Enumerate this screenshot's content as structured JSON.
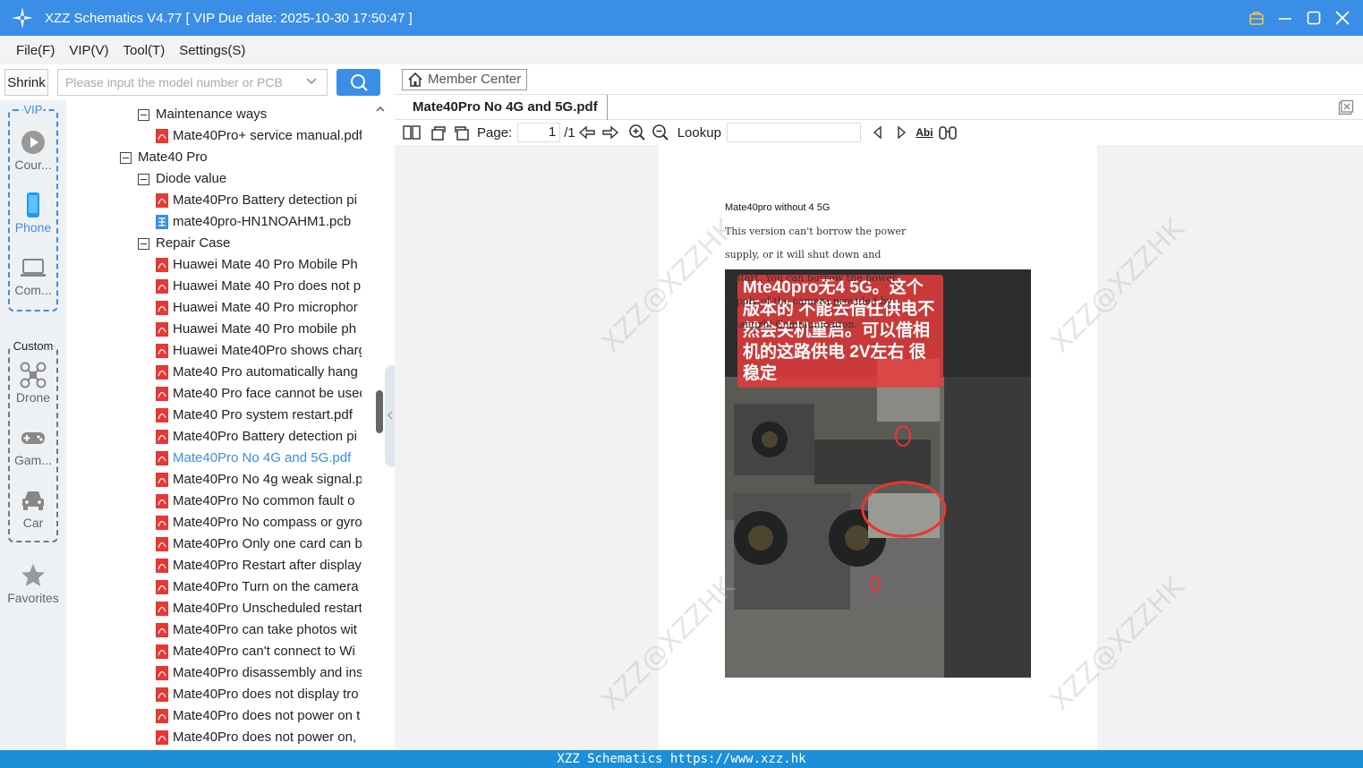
{
  "titlebar": {
    "title": "XZZ Schematics V4.77 [ VIP Due date: 2025-10-30 17:50:47 ]"
  },
  "menu": {
    "items": [
      "File(F)",
      "VIP(V)",
      "Tool(T)",
      "Settings(S)"
    ]
  },
  "search": {
    "shrink_label": "Shrink",
    "placeholder": "Please input the model number or PCB"
  },
  "categories": {
    "vip_label": "VIP",
    "custom_label": "Custom",
    "items": [
      "Cour...",
      "Phone",
      "Com...",
      "Drone",
      "Gam...",
      "Car",
      "Favorites"
    ]
  },
  "tree": {
    "nodes": [
      {
        "text": "Maintenance ways",
        "kind": "folder"
      },
      {
        "text": "Mate40Pro+ service manual.pdf",
        "kind": "pdf"
      },
      {
        "text": "Mate40 Pro",
        "kind": "folder"
      },
      {
        "text": "Diode value",
        "kind": "folder"
      },
      {
        "text": "Mate40Pro Battery detection pi",
        "kind": "pdf"
      },
      {
        "text": "mate40pro-HN1NOAHM1.pcb",
        "kind": "pcb"
      },
      {
        "text": "Repair Case",
        "kind": "folder"
      },
      {
        "text": "Huawei Mate 40 Pro Mobile Ph",
        "kind": "pdf"
      },
      {
        "text": "Huawei Mate 40 Pro does not p",
        "kind": "pdf"
      },
      {
        "text": "Huawei Mate 40 Pro microphor",
        "kind": "pdf"
      },
      {
        "text": "Huawei Mate 40 Pro mobile ph",
        "kind": "pdf"
      },
      {
        "text": "Huawei Mate40Pro shows charg",
        "kind": "pdf"
      },
      {
        "text": "Mate40 Pro automatically hang",
        "kind": "pdf"
      },
      {
        "text": "Mate40 Pro face cannot be used",
        "kind": "pdf"
      },
      {
        "text": "Mate40 Pro system restart.pdf",
        "kind": "pdf"
      },
      {
        "text": "Mate40Pro Battery detection pi",
        "kind": "pdf"
      },
      {
        "text": "Mate40Pro No 4G and 5G.pdf",
        "kind": "pdf"
      },
      {
        "text": "Mate40Pro No 4g weak signal.p",
        "kind": "pdf"
      },
      {
        "text": "Mate40Pro No common fault o",
        "kind": "pdf"
      },
      {
        "text": "Mate40Pro No compass or gyro",
        "kind": "pdf"
      },
      {
        "text": "Mate40Pro Only one card can b",
        "kind": "pdf"
      },
      {
        "text": "Mate40Pro Restart after display",
        "kind": "pdf"
      },
      {
        "text": "Mate40Pro Turn on the camera",
        "kind": "pdf"
      },
      {
        "text": "Mate40Pro Unscheduled restart",
        "kind": "pdf"
      },
      {
        "text": "Mate40Pro can take photos wit",
        "kind": "pdf"
      },
      {
        "text": "Mate40Pro can't connect to Wi",
        "kind": "pdf"
      },
      {
        "text": "Mate40Pro disassembly and ins",
        "kind": "pdf"
      },
      {
        "text": "Mate40Pro does not display tro",
        "kind": "pdf"
      },
      {
        "text": "Mate40Pro does not power on t",
        "kind": "pdf"
      },
      {
        "text": "Mate40Pro does not power on,",
        "kind": "pdf"
      }
    ],
    "selected_index": 16
  },
  "viewer": {
    "member_center": "Member Center",
    "tab_title": "Mate40Pro No 4G and 5G.pdf",
    "page_label": "Page:",
    "page_current": "1",
    "page_total": "/1",
    "lookup_label": "Lookup",
    "abi_label": "Abi"
  },
  "pdf": {
    "heading": "Mate40pro without 4 5G",
    "lines": [
      "This version can't borrow the power",
      "supply, or it will shut down and",
      "restart. You can borrow the power",
      "supply of the camera provided by",
      "Guangzhi Communication."
    ],
    "overlay_text": "Mte40pro无4 5G。这个版本的 不能去借任供电不然会关机重启。可以借相机的这路供电 2V左右 很稳定",
    "watermark": "XZZ@XZZHK"
  },
  "status": {
    "text": "XZZ Schematics https://www.xzz.hk"
  },
  "colors": {
    "accent": "#3a8ee6",
    "pdf_icon": "#e53935",
    "status": "#1d8fd8"
  }
}
